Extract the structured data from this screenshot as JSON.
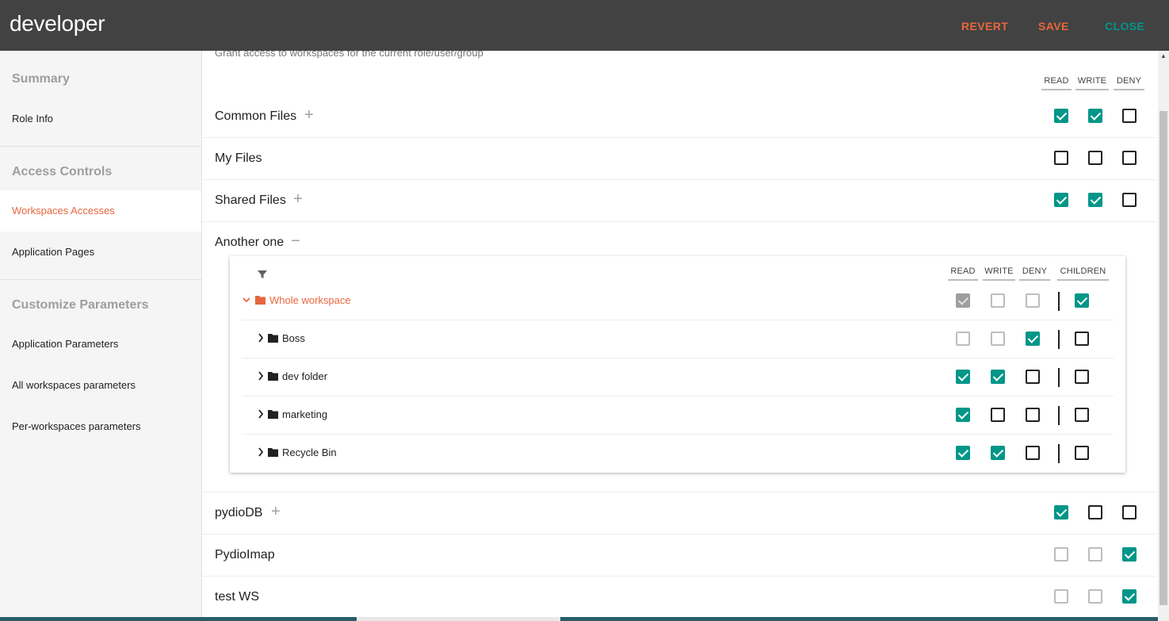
{
  "header": {
    "title": "developer",
    "revert_label": "REVERT",
    "save_label": "SAVE",
    "close_label": "CLOSE",
    "accent_color": "#e8663d",
    "close_color": "#009688"
  },
  "sidebar": {
    "sections": [
      {
        "heading": "Summary",
        "items": [
          "Role Info"
        ]
      },
      {
        "heading": "Access Controls",
        "items": [
          "Workspaces Accesses",
          "Application Pages"
        ]
      },
      {
        "heading": "Customize Parameters",
        "items": [
          "Application Parameters",
          "All workspaces parameters",
          "Per-workspaces parameters"
        ]
      }
    ],
    "active_item": "Workspaces Accesses"
  },
  "main": {
    "description": "Grant access to workspaces for the current role/user/group",
    "columns": [
      "READ",
      "WRITE",
      "DENY"
    ],
    "workspaces": [
      {
        "name": "Common Files",
        "toggle": "+",
        "read": true,
        "write": true,
        "deny": false,
        "disabled": false
      },
      {
        "name": "My Files",
        "toggle": "",
        "read": false,
        "write": false,
        "deny": false,
        "disabled": false
      },
      {
        "name": "Shared Files",
        "toggle": "+",
        "read": true,
        "write": true,
        "deny": false,
        "disabled": false
      },
      {
        "name": "Another one",
        "toggle": "−",
        "expanded": true
      },
      {
        "name": "pydioDB",
        "toggle": "+",
        "read": true,
        "write": false,
        "deny": false,
        "disabled": false
      },
      {
        "name": "PydioImap",
        "toggle": "",
        "read": false,
        "write": false,
        "deny": true,
        "disabled": true
      },
      {
        "name": "test WS",
        "toggle": "",
        "read": false,
        "write": false,
        "deny": true,
        "disabled": true
      }
    ],
    "tree": {
      "columns": [
        "READ",
        "WRITE",
        "DENY",
        "CHILDREN"
      ],
      "filter_icon": "filter-icon",
      "nodes": [
        {
          "label": "Whole workspace",
          "root": true,
          "read": true,
          "write": false,
          "deny": false,
          "children": true,
          "disabled": true
        },
        {
          "label": "Boss",
          "root": false,
          "read": false,
          "write": false,
          "deny": true,
          "children": false,
          "disabled": true
        },
        {
          "label": "dev folder",
          "root": false,
          "read": true,
          "write": true,
          "deny": false,
          "children": false,
          "disabled": false
        },
        {
          "label": "marketing",
          "root": false,
          "read": true,
          "write": false,
          "deny": false,
          "children": false,
          "disabled": false
        },
        {
          "label": "Recycle Bin",
          "root": false,
          "read": true,
          "write": true,
          "deny": false,
          "children": false,
          "disabled": false
        }
      ]
    }
  },
  "colors": {
    "topbar": "#424242",
    "check": "#009688",
    "accent": "#e8663d"
  }
}
